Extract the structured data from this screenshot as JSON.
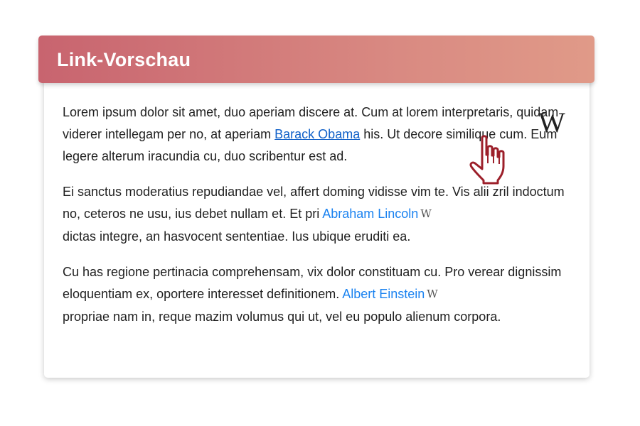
{
  "header": {
    "title": "Link-Vorschau"
  },
  "paragraphs": [
    {
      "before": "Lorem ipsum dolor sit amet, duo aperiam discere at. Cum at lorem interpretaris, quidam viderer intellegam per no, at aperiam ",
      "link": "Barack Obama",
      "after": " his. Ut decore similique cum. Eum legere alterum iracundia cu, duo scribentur est ad."
    },
    {
      "before": "Ei sanctus moderatius repudiandae vel, affert doming vidisse vim te. Vis alii zril indoctum no, ceteros ne usu, ius debet nullam et. Et pri ",
      "link": "Abraham Lincoln",
      "after": "dictas integre, an hasvocent sententiae. Ius ubique eruditi ea."
    },
    {
      "before": "Cu has regione pertinacia comprehensam, vix dolor constituam cu. Pro verear dignissim eloquentiam ex, oportere interesset definitionem. ",
      "link": "Albert Einstein",
      "after": "propriae nam in, reque mazim volumus qui ut, vel eu populo alienum corpora."
    }
  ],
  "wiki_badge": "W",
  "wiki_preview_logo": "W",
  "icons": {
    "wikipedia": "wikipedia-icon",
    "cursor": "hand-pointer-cursor-icon"
  },
  "colors": {
    "header_gradient_start": "#c8646f",
    "header_gradient_end": "#e09a88",
    "link": "#1a82f0",
    "link_hover": "#1060c8",
    "cursor_outline": "#9c1f2a"
  }
}
